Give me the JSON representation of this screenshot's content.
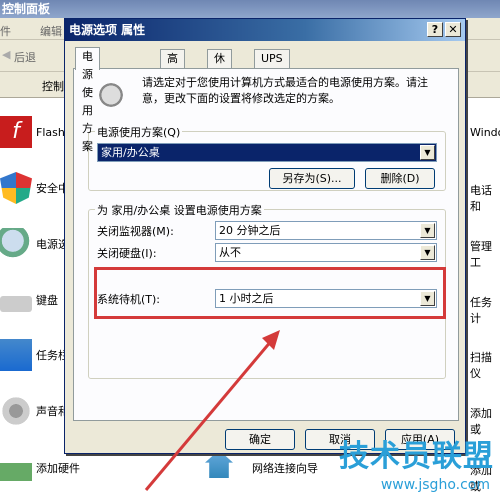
{
  "bg": {
    "title": "控制面板",
    "menu": [
      "件",
      "编辑"
    ],
    "toolbar_back": "后退",
    "address": "控制",
    "items_left": [
      {
        "label": "Flash",
        "icon": "flash-icon"
      },
      {
        "label": "安全中",
        "icon": "security-shield-icon"
      },
      {
        "label": "电源选",
        "icon": "power-plug-icon"
      },
      {
        "label": "键盘",
        "icon": "keyboard-icon"
      },
      {
        "label": "任务栏",
        "icon": "taskbar-icon"
      },
      {
        "label": "声音和",
        "icon": "speaker-icon"
      },
      {
        "label": "添加硬件",
        "icon": "hardware-icon"
      }
    ],
    "items_right": [
      "Windo",
      "电话和",
      "管理工",
      "任务计",
      "扫描仪",
      "添加或",
      "添加或"
    ],
    "bottom_mid": "网络连接向导"
  },
  "dialog": {
    "title": "电源选项 属性",
    "help_btn": "?",
    "close_btn": "✕",
    "tabs": [
      "电源使用方案",
      "高级",
      "休眠",
      "UPS"
    ],
    "description": "请选定对于您使用计算机方式最适合的电源使用方案。请注意，更改下面的设置将修改选定的方案。",
    "scheme_group": "电源使用方案(Q)",
    "scheme_value": "家用/办公桌",
    "save_as": "另存为(S)...",
    "delete": "删除(D)",
    "settings_group": "为 家用/办公桌 设置电源使用方案",
    "monitor_label": "关闭监视器(M):",
    "monitor_value": "20 分钟之后",
    "disk_label": "关闭硬盘(I):",
    "disk_value": "从不",
    "standby_label": "系统待机(T):",
    "standby_value": "1 小时之后",
    "ok": "确定",
    "cancel": "取消",
    "apply": "应用(A)"
  },
  "watermark": "技术员联盟",
  "watermark_url": "www.jsgho.com"
}
